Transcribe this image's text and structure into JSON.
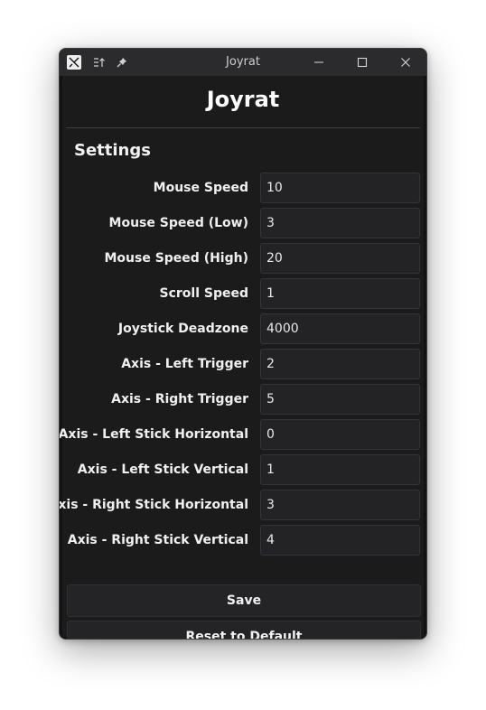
{
  "window": {
    "title": "Joyrat"
  },
  "titlebar_icons": {
    "app_logo": "app-logo-icon",
    "sort": "sort-icon",
    "pin": "pin-icon",
    "minimize": "minimize-icon",
    "maximize": "maximize-icon",
    "close": "close-icon"
  },
  "app": {
    "heading": "Joyrat",
    "section_title": "Settings"
  },
  "settings": [
    {
      "label": "Mouse Speed",
      "value": "10"
    },
    {
      "label": "Mouse Speed (Low)",
      "value": "3"
    },
    {
      "label": "Mouse Speed (High)",
      "value": "20"
    },
    {
      "label": "Scroll Speed",
      "value": "1"
    },
    {
      "label": "Joystick Deadzone",
      "value": "4000"
    },
    {
      "label": "Axis - Left Trigger",
      "value": "2"
    },
    {
      "label": "Axis - Right Trigger",
      "value": "5"
    },
    {
      "label": "Axis - Left Stick Horizontal",
      "value": "0"
    },
    {
      "label": "Axis - Left Stick Vertical",
      "value": "1"
    },
    {
      "label": "Axis - Right Stick Horizontal",
      "value": "3"
    },
    {
      "label": "Axis - Right Stick Vertical",
      "value": "4"
    }
  ],
  "buttons": {
    "save": "Save",
    "reset": "Reset to Default"
  },
  "colors": {
    "background": "#1b1b1c",
    "titlebar": "#2b2b2e",
    "input_bg": "#232326",
    "text": "#f0f0f0"
  }
}
